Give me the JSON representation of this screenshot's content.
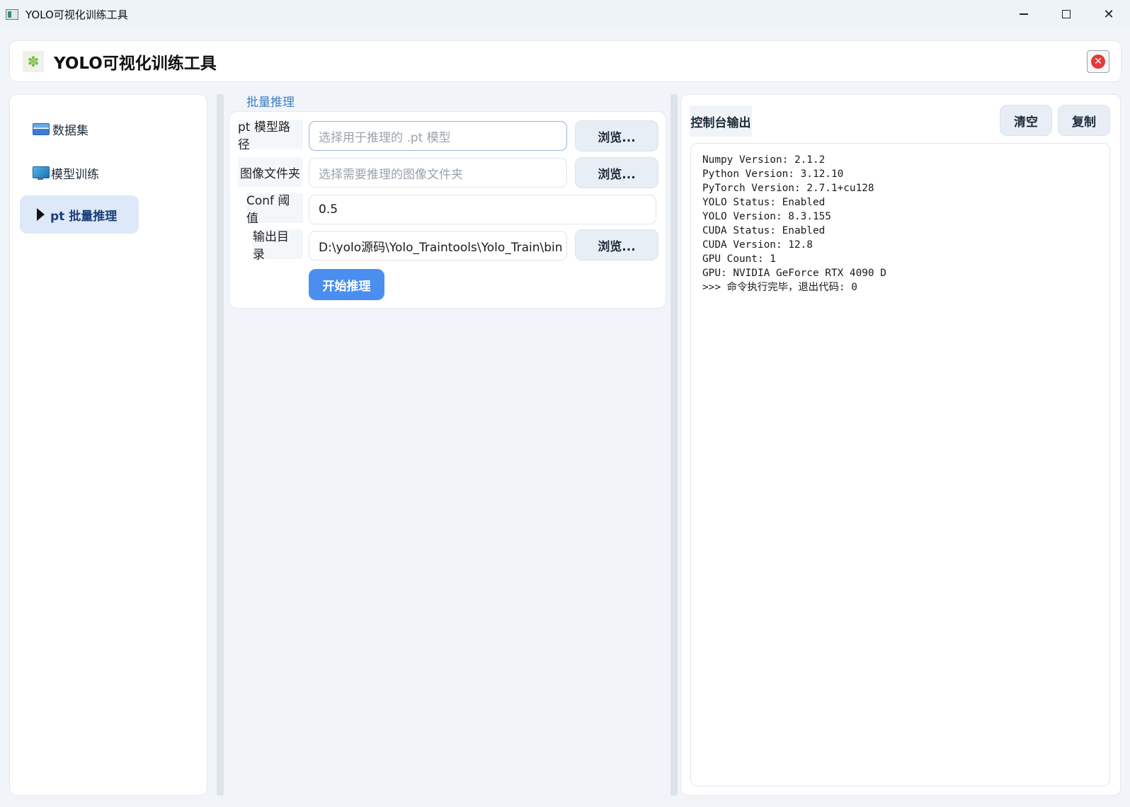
{
  "window": {
    "title": "YOLO可视化训练工具",
    "controls": {
      "minimize": "minimize",
      "maximize": "maximize",
      "close": "✕"
    }
  },
  "header": {
    "logo": "✽",
    "title": "YOLO可视化训练工具",
    "close_icon": "✕"
  },
  "sidebar": {
    "items": [
      {
        "label": "数据集",
        "icon": "folder-icon",
        "active": false
      },
      {
        "label": "模型训练",
        "icon": "monitor-icon",
        "active": false
      },
      {
        "label": "pt 批量推理",
        "icon": "play-triangle-icon",
        "active": true
      }
    ]
  },
  "inference": {
    "section_title": "批量推理",
    "model_path": {
      "label": "pt 模型路径",
      "value": "",
      "placeholder": "选择用于推理的 .pt 模型"
    },
    "image_folder": {
      "label": "图像文件夹",
      "value": "",
      "placeholder": "选择需要推理的图像文件夹"
    },
    "conf": {
      "label": "Conf 阈值",
      "value": "0.5"
    },
    "output_dir": {
      "label": "输出目录",
      "value": "D:\\yolo源码\\Yolo_Traintools\\Yolo_Train\\bin"
    },
    "browse_label": "浏览...",
    "start_label": "开始推理"
  },
  "console": {
    "title": "控制台输出",
    "clear_label": "清空",
    "copy_label": "复制",
    "lines": [
      "Numpy Version: 2.1.2",
      "Python Version: 3.12.10",
      "PyTorch Version: 2.7.1+cu128",
      "YOLO Status: Enabled",
      "YOLO Version: 8.3.155",
      "CUDA Status: Enabled",
      "CUDA Version: 12.8",
      "GPU Count: 1",
      "GPU: NVIDIA GeForce RTX 4090 D",
      ">>> 命令执行完毕，退出代码: 0"
    ]
  },
  "colors": {
    "accent": "#4a8ff0",
    "section_title": "#3f7fc4",
    "active_nav_bg": "#dde9f8",
    "close_red": "#e33a3a",
    "logo_green": "#7cc142"
  }
}
